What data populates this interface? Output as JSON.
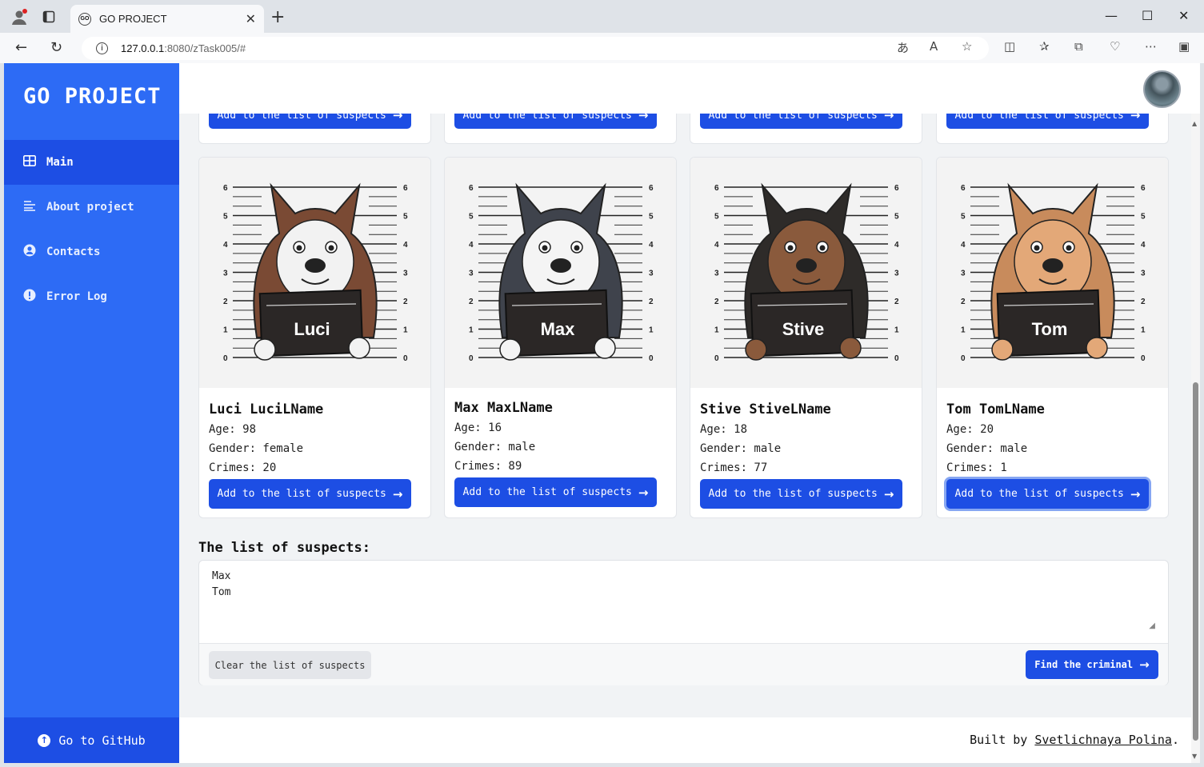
{
  "browser": {
    "tab_title": "GO PROJECT",
    "tab_favicon": "GO",
    "url_host": "127.0.0.1",
    "url_path": ":8080/zTask005/#"
  },
  "sidebar": {
    "brand": "GO PROJECT",
    "items": [
      {
        "label": "Main",
        "icon": "grid-icon"
      },
      {
        "label": "About project",
        "icon": "text-lines-icon"
      },
      {
        "label": "Contacts",
        "icon": "user-circle-icon"
      },
      {
        "label": "Error Log",
        "icon": "alert-circle-icon"
      }
    ],
    "github_label": "Go to GitHub"
  },
  "cards_top": {
    "button_label": "Add to the list of suspects"
  },
  "cards": [
    {
      "sign": "Luci",
      "name": "Luci LuciLName",
      "age": "Age: 98",
      "gender": "Gender: female",
      "crimes": "Crimes: 20",
      "button": "Add to the list of suspects",
      "fur": "#7a4a34",
      "face": "#f2f2f2"
    },
    {
      "sign": "Max",
      "name": "Max MaxLName",
      "age": "Age: 16",
      "gender": "Gender: male",
      "crimes": "Crimes: 89",
      "button": "Add to the list of suspects",
      "fur": "#3f434c",
      "face": "#f4f4f4"
    },
    {
      "sign": "Stive",
      "name": "Stive StiveLName",
      "age": "Age: 18",
      "gender": "Gender: male",
      "crimes": "Crimes: 77",
      "button": "Add to the list of suspects",
      "fur": "#2e2b29",
      "face": "#8a5a3c"
    },
    {
      "sign": "Tom",
      "name": "Tom TomLName",
      "age": "Age: 20",
      "gender": "Gender: male",
      "crimes": "Crimes: 1",
      "button": "Add to the list of suspects",
      "fur": "#c88b5c",
      "face": "#e3a878"
    }
  ],
  "suspects": {
    "title": "The list of suspects:",
    "text": "Max\nTom",
    "clear_label": "Clear the list of suspects",
    "find_label": "Find the criminal"
  },
  "footer": {
    "built_prefix": "Built by ",
    "author": "Svetlichnaya Polina",
    "built_suffix": "."
  },
  "colors": {
    "sidebar": "#2d6bf5",
    "sidebar_active": "#1d4ee4",
    "button": "#1d4ee4"
  }
}
